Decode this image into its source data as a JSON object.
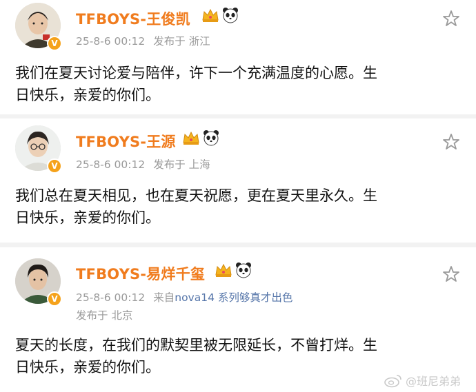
{
  "posts": [
    {
      "name": "TFBOYS-王俊凯",
      "timestamp": "25-8-6 00:12",
      "meta": "发布于 浙江",
      "line1": "我们在夏天讨论爱与陪伴，许下一个充满温度的心愿。生",
      "line2": "日快乐，亲爱的你们。"
    },
    {
      "name": "TFBOYS-王源",
      "timestamp": "25-8-6 00:12",
      "meta": "发布于 上海",
      "line1": "我们总在夏天相见，也在夏天祝愿，更在夏天里永久。生",
      "line2": "日快乐，亲爱的你们。"
    },
    {
      "name": "TFBOYS-易烊千玺",
      "timestamp": "25-8-6 00:12",
      "source_prefix": "来自",
      "source": "nova14 系列够真才出色",
      "meta": "发布于 北京",
      "line1": "夏天的长度，在我们的默契里被无限延长，不曾打烊。生",
      "line2": "日快乐，亲爱的你们。"
    }
  ],
  "verified_badge": "V",
  "watermark": "@班尼弟弟",
  "colors": {
    "name": "#f07c1e",
    "meta": "#9a9a9a",
    "link": "#5575a9",
    "badge": "#f5a21b",
    "separator": "#f2f2f2"
  },
  "icons": [
    "crown-icon",
    "panda-icon",
    "star-icon",
    "verified-badge-icon",
    "weibo-logo-icon"
  ]
}
